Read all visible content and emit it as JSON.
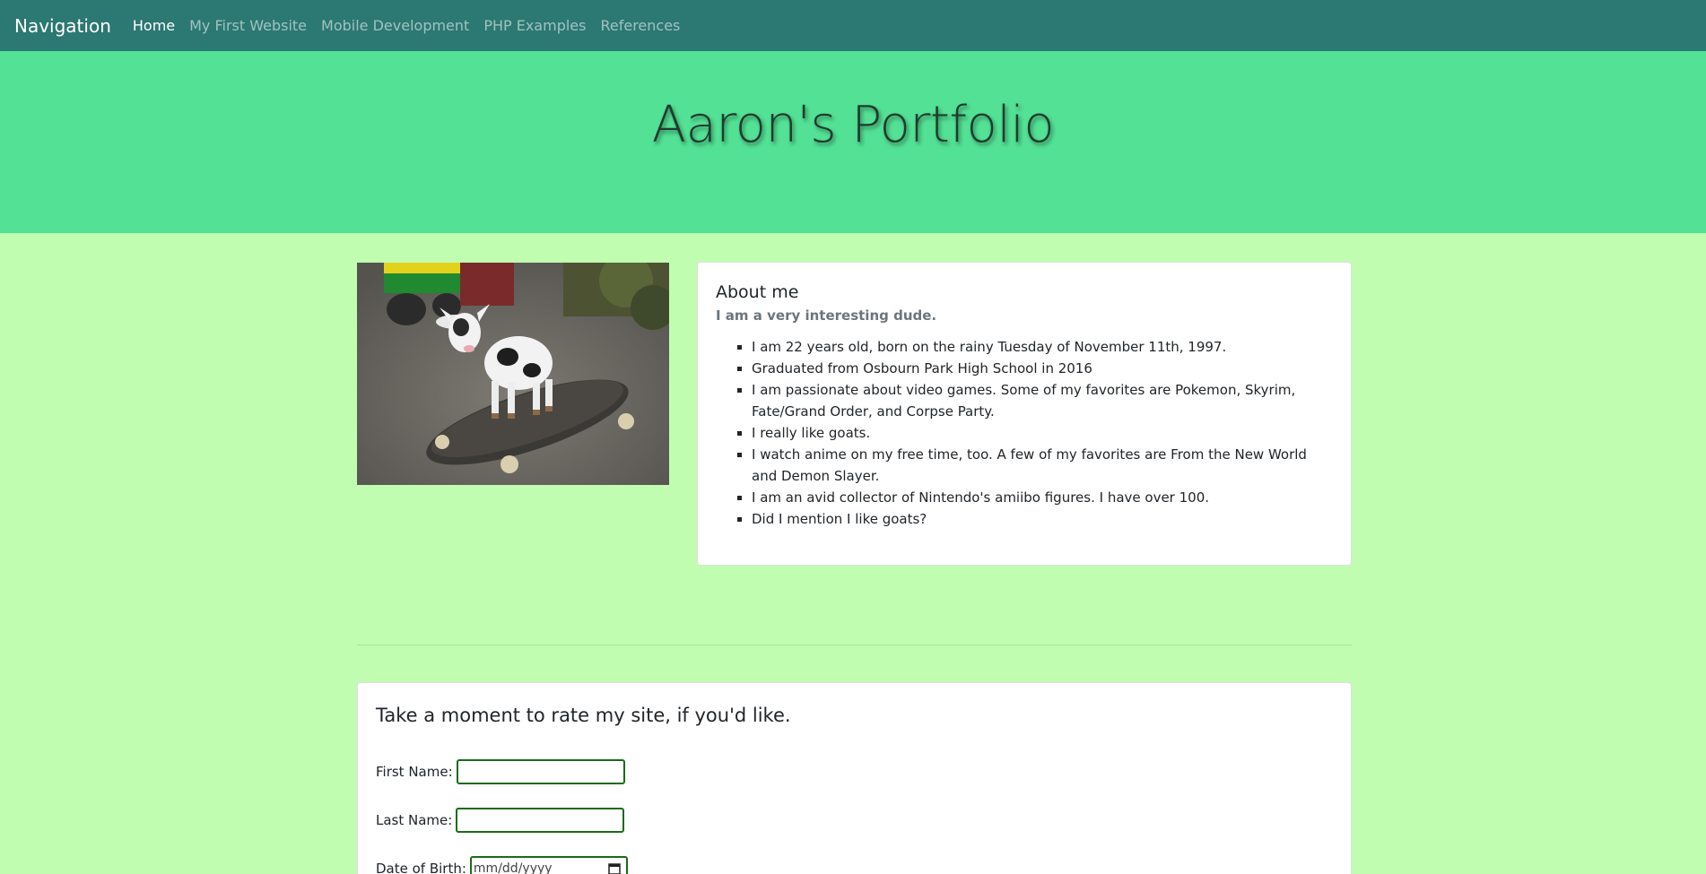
{
  "navbar": {
    "brand": "Navigation",
    "links": [
      {
        "label": "Home",
        "active": true
      },
      {
        "label": "My First Website",
        "active": false
      },
      {
        "label": "Mobile Development",
        "active": false
      },
      {
        "label": "PHP Examples",
        "active": false
      },
      {
        "label": "References",
        "active": false
      }
    ]
  },
  "hero": {
    "title": "Aaron's Portfolio"
  },
  "about": {
    "title": "About me",
    "subtitle": "I am a very interesting dude.",
    "items": [
      "I am 22 years old, born on the rainy Tuesday of November 11th, 1997.",
      "Graduated from Osbourn Park High School in 2016",
      "I am passionate about video games. Some of my favorites are Pokemon, Skyrim, Fate/Grand Order, and Corpse Party.",
      "I really like goats.",
      "I watch anime on my free time, too. A few of my favorites are From the New World and Demon Slayer.",
      "I am an avid collector of Nintendo's amiibo figures. I have over 100.",
      "Did I mention I like goats?"
    ]
  },
  "rating": {
    "title": "Take a moment to rate my site, if you'd like.",
    "first_name_label": "First Name:",
    "first_name_value": "",
    "last_name_label": "Last Name:",
    "last_name_value": "",
    "dob_label": "Date of Birth:",
    "dob_placeholder": "mm/dd/yyyy"
  },
  "colors": {
    "navbar": "#2c7873",
    "hero": "#53e195",
    "page": "#c0fdb0",
    "input_border": "#1a6b1a"
  }
}
